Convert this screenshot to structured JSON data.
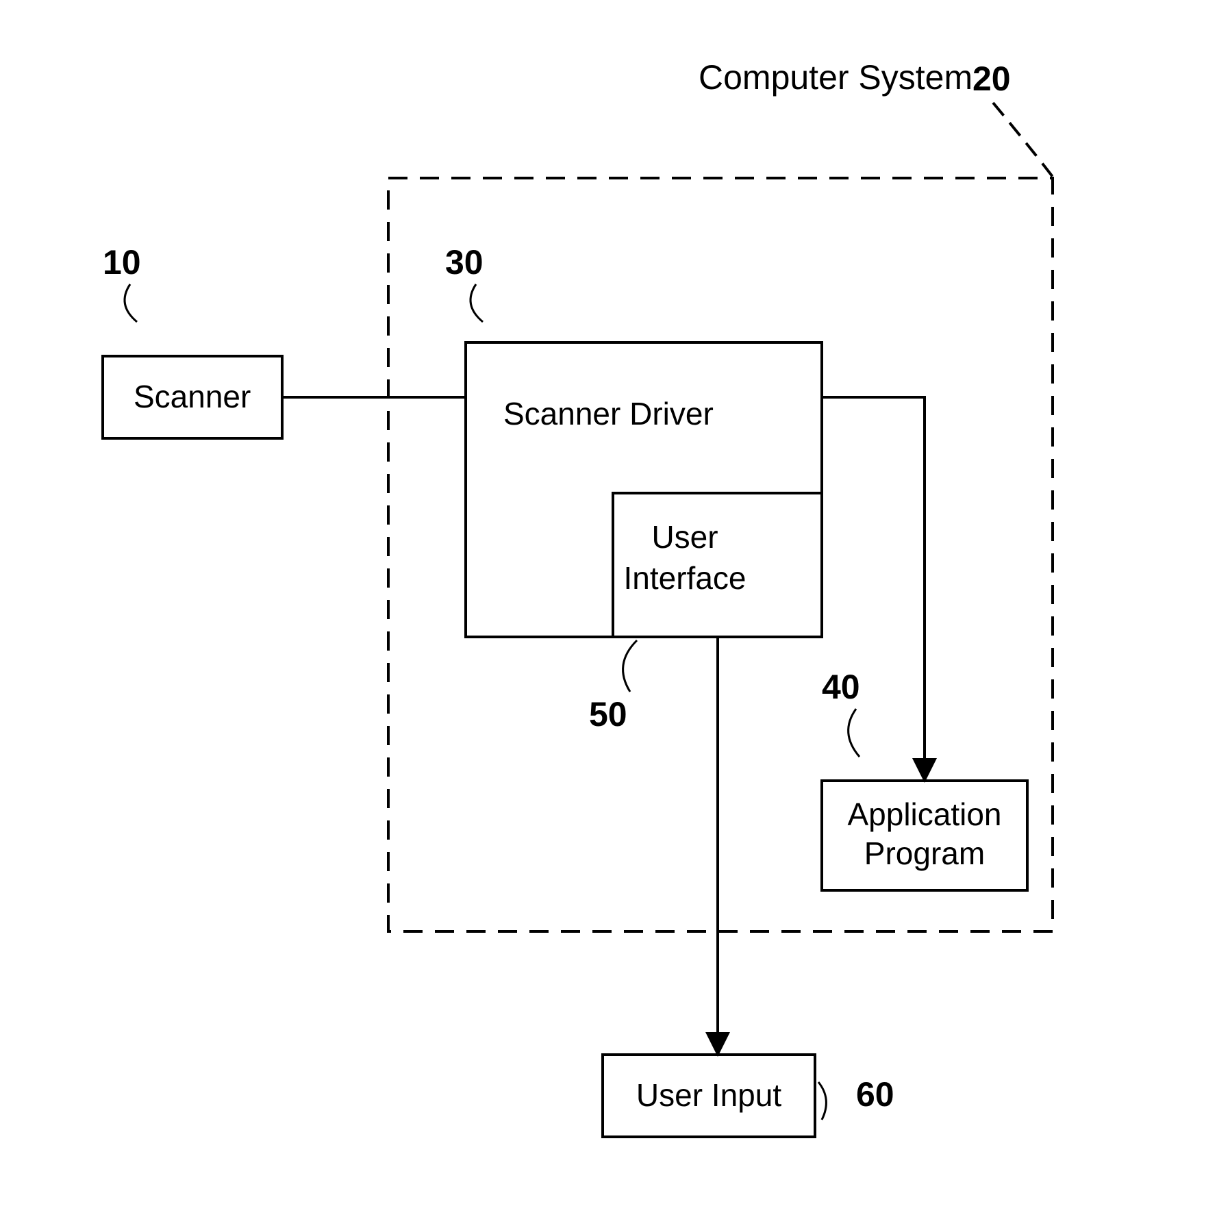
{
  "title": "Computer System",
  "refs": {
    "scanner": "10",
    "system": "20",
    "driver": "30",
    "app": "40",
    "ui": "50",
    "input": "60"
  },
  "blocks": {
    "scanner": "Scanner",
    "driver": "Scanner Driver",
    "ui_line1": "User",
    "ui_line2": "Interface",
    "app_line1": "Application",
    "app_line2": "Program",
    "input": "User Input"
  }
}
